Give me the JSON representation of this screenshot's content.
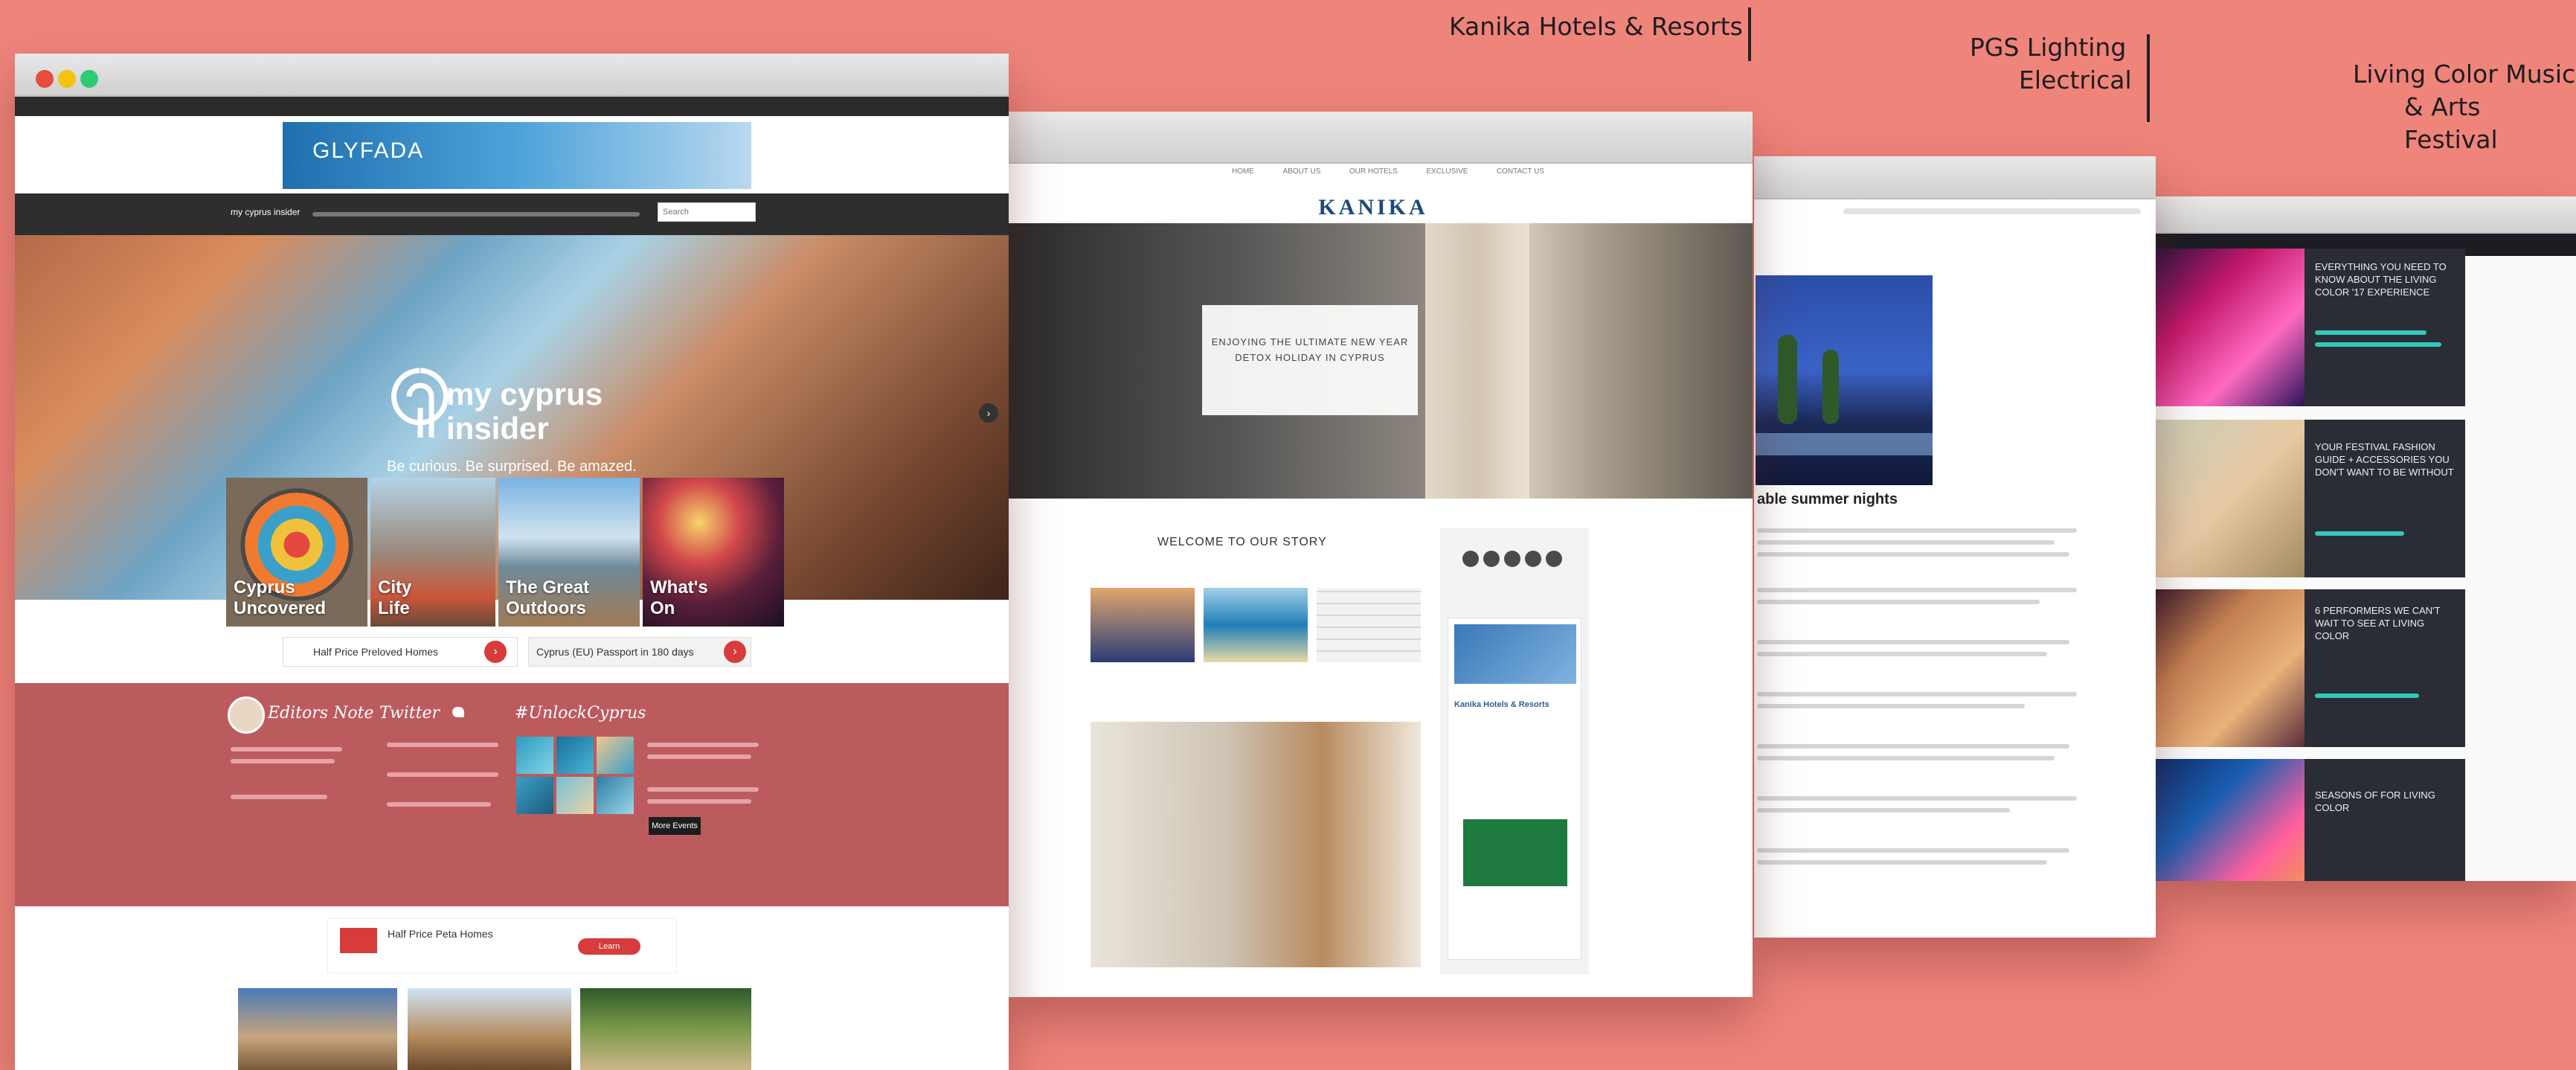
{
  "captions": {
    "kanika": "Kanika Hotels & Resorts",
    "pgs_line1": "PGS Lighting",
    "pgs_line2": "Electrical",
    "living_line1": "Living Color Music",
    "living_line2": "& Arts Festival"
  },
  "mycyprus": {
    "top_ad": "GLYFADA",
    "search_placeholder": "Search",
    "logo_small": "my cyprus insider",
    "hero_logo_line1": "my cyprus",
    "hero_logo_line2": "insider",
    "hero_tagline": "Be curious. Be surprised. Be amazed.",
    "tiles": [
      {
        "line1": "Cyprus",
        "line2": "Uncovered"
      },
      {
        "line1": "City",
        "line2": "Life"
      },
      {
        "line1": "The Great",
        "line2": "Outdoors"
      },
      {
        "line1": "What's",
        "line2": "On"
      }
    ],
    "promo_left": "Half Price Preloved Homes",
    "promo_right": "Cyprus (EU) Passport in 180 days",
    "editor_heading": "Editors Note",
    "twitter_heading": "Twitter",
    "unlock_heading": "#UnlockCyprus",
    "more_button": "More Events",
    "bottom_ad": "Half Price Peta Homes",
    "bottom_ad_button": "Learn"
  },
  "kanika": {
    "nav": [
      "HOME",
      "ABOUT US",
      "OUR HOTELS",
      "EXCLUSIVE",
      "CONTACT US"
    ],
    "logo": "KANIKA",
    "hero_line1": "ENJOYING THE ULTIMATE NEW YEAR",
    "hero_line2": "DETOX HOLIDAY IN CYPRUS",
    "welcome": "WELCOME TO OUR STORY",
    "fb_page": "Kanika Hotels & Resorts"
  },
  "pgs": {
    "headline": "able summer nights"
  },
  "living": {
    "cards": [
      "EVERYTHING YOU NEED TO KNOW ABOUT THE LIVING COLOR '17 EXPERIENCE",
      "YOUR FESTIVAL FASHION GUIDE + ACCESSORIES YOU DON'T WANT TO BE WITHOUT",
      "6 PERFORMERS WE CAN'T WAIT TO SEE AT LIVING COLOR",
      "SEASONS OF FOR LIVING COLOR"
    ]
  },
  "colors": {
    "background": "#ef847b",
    "mycyprus_band": "#bc5b5e",
    "living_dark": "#2a2c36",
    "living_accent": "#33c9b8"
  }
}
